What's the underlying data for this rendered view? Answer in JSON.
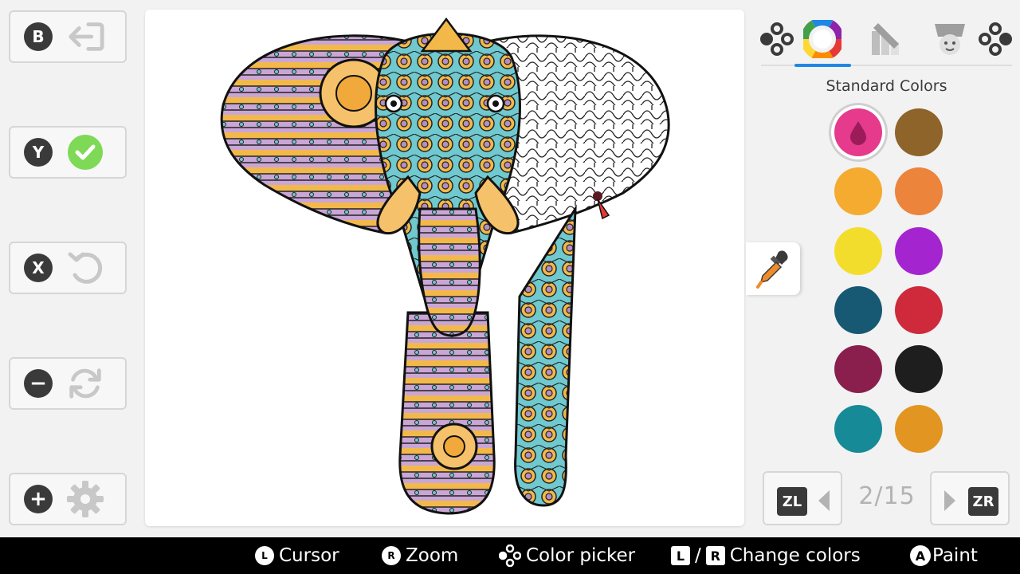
{
  "left_controls": [
    {
      "glyph": "B",
      "action_icon": "back-arrow-icon"
    },
    {
      "glyph": "Y",
      "action_icon": "confirm-check-icon"
    },
    {
      "glyph": "X",
      "action_icon": "undo-icon"
    },
    {
      "glyph": "−",
      "action_icon": "refresh-icon"
    },
    {
      "glyph": "+",
      "action_icon": "settings-gear-icon"
    }
  ],
  "colors": {
    "accent_tab": "#1e88e5",
    "confirm_green": "#7ed957"
  },
  "tabs": [
    "color-palette",
    "gradient-tool",
    "fill-bucket"
  ],
  "palette": {
    "title": "Standard Colors",
    "selected_index": 0,
    "swatches": [
      "#e63a8c",
      "#8e642a",
      "#f5aa30",
      "#ec843b",
      "#f3dd2c",
      "#a425cf",
      "#175872",
      "#ce2a3c",
      "#8a1f4e",
      "#1e1e1e",
      "#168a96",
      "#e39521"
    ]
  },
  "pager": {
    "prev_badge": "ZL",
    "next_badge": "ZR",
    "page": "2/15"
  },
  "hints": [
    {
      "icon": "L",
      "label": "Cursor"
    },
    {
      "icon": "R",
      "label": "Zoom"
    },
    {
      "icon": "buttons-cluster-icon",
      "label": "Color picker"
    },
    {
      "l": "L",
      "sep": "/",
      "r": "R",
      "label": "Change colors"
    },
    {
      "icon": "A",
      "label": "Paint"
    }
  ]
}
